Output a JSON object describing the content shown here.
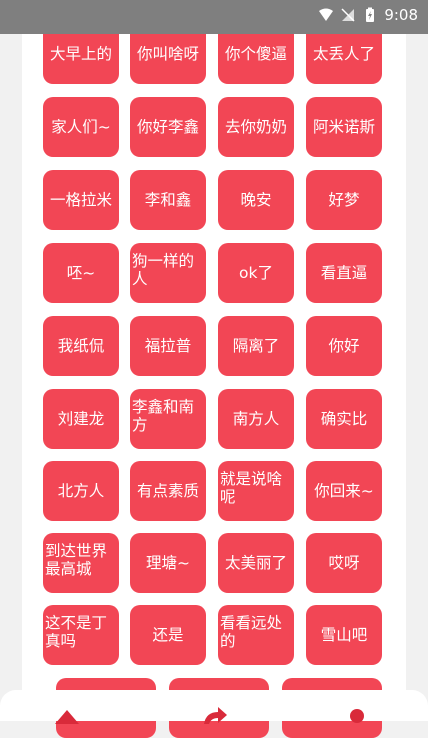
{
  "status": {
    "time": "9:08"
  },
  "theme": {
    "tile_color": "#f24655",
    "panel": "#ffffff",
    "statusbar": "#7f7f7f"
  },
  "rows": [
    {
      "tiles": [
        "大早上的",
        "你叫啥呀",
        "你个傻逼",
        "太丢人了"
      ]
    },
    {
      "tiles": [
        "家人们~",
        "你好李鑫",
        "去你奶奶",
        "阿米诺斯"
      ]
    },
    {
      "tiles": [
        "一格拉米",
        "李和鑫",
        "晚安",
        "好梦"
      ]
    },
    {
      "tiles": [
        "呸~",
        "狗一样的人",
        "ok了",
        "看直逼"
      ]
    },
    {
      "tiles": [
        "我纸侃",
        "福拉普",
        "隔离了",
        "你好"
      ]
    },
    {
      "tiles": [
        "刘建龙",
        "李鑫和南方",
        "南方人",
        "确实比"
      ]
    },
    {
      "tiles": [
        "北方人",
        "有点素质",
        "就是说啥呢",
        "你回来~"
      ]
    },
    {
      "tiles": [
        "到达世界最高城",
        "理塘~",
        "太美丽了",
        "哎呀"
      ]
    },
    {
      "tiles": [
        "这不是丁真吗",
        "还是",
        "看看远处的",
        "雪山吧"
      ]
    }
  ],
  "nav": {
    "icons": [
      "home-icon",
      "refresh-icon",
      "profile-icon"
    ]
  }
}
